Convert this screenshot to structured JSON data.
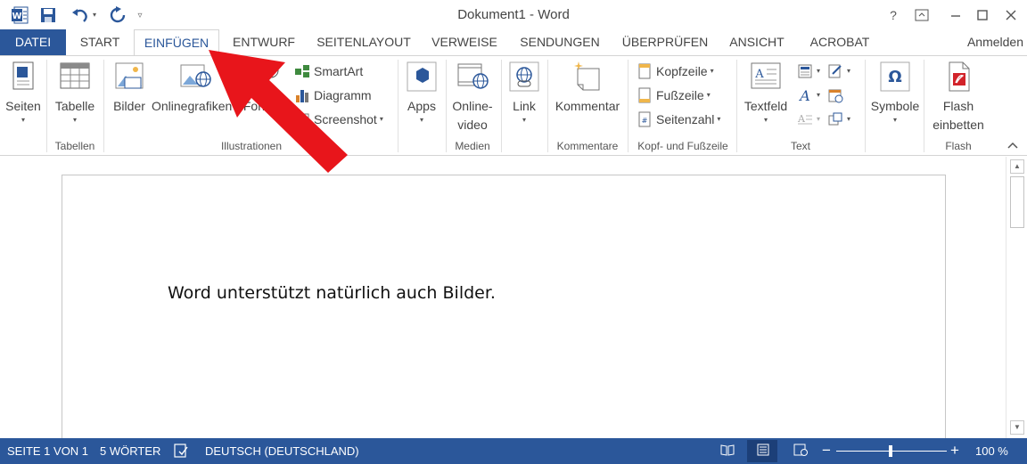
{
  "window": {
    "title": "Dokument1 - Word",
    "help_label": "?",
    "sign_in": "Anmelden"
  },
  "tabs": [
    {
      "label": "DATEI"
    },
    {
      "label": "START"
    },
    {
      "label": "EINFÜGEN"
    },
    {
      "label": "ENTWURF"
    },
    {
      "label": "SEITENLAYOUT"
    },
    {
      "label": "VERWEISE"
    },
    {
      "label": "SENDUNGEN"
    },
    {
      "label": "ÜBERPRÜFEN"
    },
    {
      "label": "ANSICHT"
    },
    {
      "label": "ACROBAT"
    }
  ],
  "ribbon": {
    "seiten": "Seiten",
    "tabelle": "Tabelle",
    "group_tabellen": "Tabellen",
    "bilder": "Bilder",
    "onlinegrafiken": "Onlinegrafiken",
    "formen": "Formen",
    "smartart": "SmartArt",
    "diagramm": "Diagramm",
    "screenshot": "Screenshot",
    "group_illustrationen": "Illustrationen",
    "apps": "Apps",
    "onlinevideo_1": "Online-",
    "onlinevideo_2": "video",
    "group_medien": "Medien",
    "link": "Link",
    "kommentar": "Kommentar",
    "group_kommentare": "Kommentare",
    "kopfzeile": "Kopfzeile",
    "fusszeile": "Fußzeile",
    "seitenzahl": "Seitenzahl",
    "group_kopf_fuss": "Kopf- und Fußzeile",
    "textfeld": "Textfeld",
    "group_text": "Text",
    "symbole": "Symbole",
    "flash_1": "Flash",
    "flash_2": "einbetten",
    "group_flash": "Flash"
  },
  "document": {
    "text": "Word unterstützt natürlich auch Bilder."
  },
  "statusbar": {
    "page": "SEITE 1 VON 1",
    "words": "5 WÖRTER",
    "language": "DEUTSCH (DEUTSCHLAND)",
    "zoom": "100 %",
    "zoom_minus": "−",
    "zoom_plus": "+"
  },
  "colors": {
    "brand": "#2B579A",
    "arrow": "#E8151B"
  },
  "icons": {
    "word_logo": "word-logo-icon",
    "save": "save-icon",
    "undo": "undo-icon",
    "redo": "redo-icon"
  }
}
